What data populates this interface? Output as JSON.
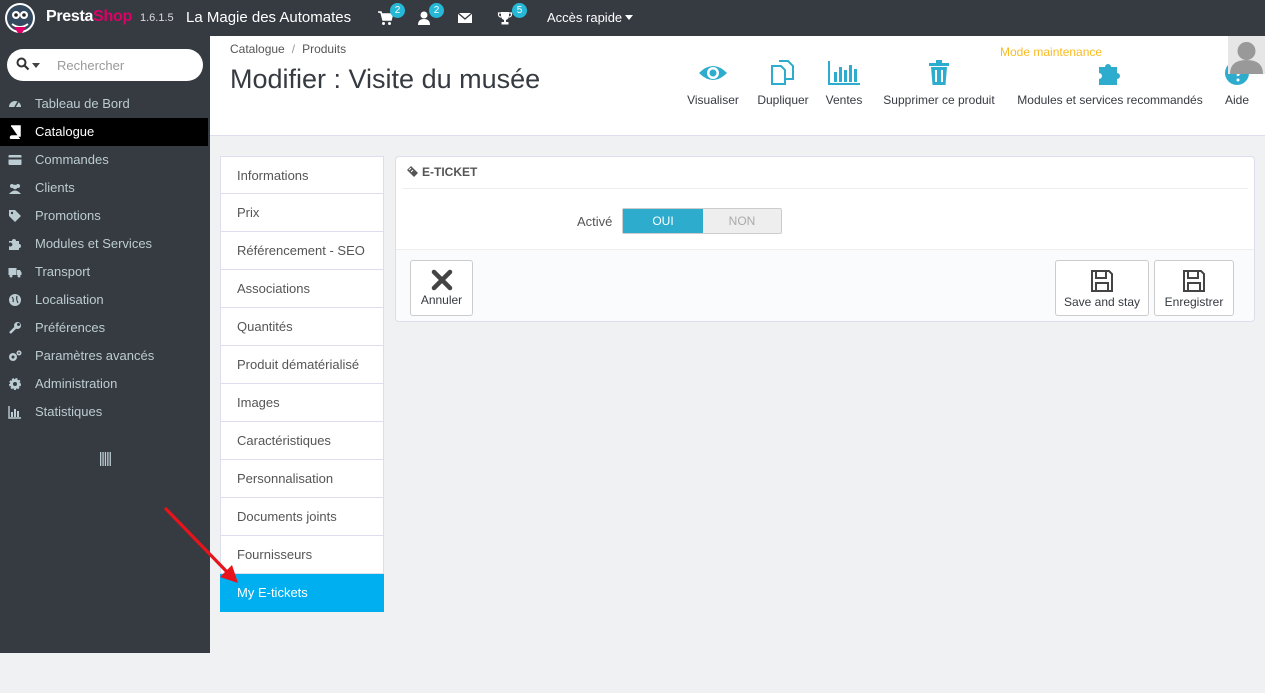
{
  "topbar": {
    "brand_part1": "Presta",
    "brand_part2": "Shop",
    "version": "1.6.1.5",
    "shop_name": "La Magie des Automates",
    "notifications": [
      {
        "icon": "cart-icon",
        "count": "2"
      },
      {
        "icon": "user-icon",
        "count": "2"
      },
      {
        "icon": "envelope-icon",
        "count": ""
      },
      {
        "icon": "trophy-icon",
        "count": "5"
      }
    ],
    "quick_access": "Accès rapide"
  },
  "sidebar": {
    "search_placeholder": "Rechercher",
    "items": [
      {
        "label": "Tableau de Bord",
        "icon": "dashboard-icon"
      },
      {
        "label": "Catalogue",
        "icon": "book-icon",
        "active": true
      },
      {
        "label": "Commandes",
        "icon": "credit-card-icon"
      },
      {
        "label": "Clients",
        "icon": "users-icon"
      },
      {
        "label": "Promotions",
        "icon": "tags-icon"
      },
      {
        "label": "Modules et Services",
        "icon": "puzzle-icon"
      },
      {
        "label": "Transport",
        "icon": "truck-icon"
      },
      {
        "label": "Localisation",
        "icon": "globe-icon"
      },
      {
        "label": "Préférences",
        "icon": "wrench-icon"
      },
      {
        "label": "Paramètres avancés",
        "icon": "cogs-icon"
      },
      {
        "label": "Administration",
        "icon": "cog-icon"
      },
      {
        "label": "Statistiques",
        "icon": "bar-chart-icon"
      }
    ]
  },
  "header": {
    "breadcrumb": [
      "Catalogue",
      "Produits"
    ],
    "title": "Modifier : Visite du musée",
    "maintenance": "Mode maintenance",
    "toolbar": {
      "view": "Visualiser",
      "duplicate": "Dupliquer",
      "sales": "Ventes",
      "delete": "Supprimer ce produit",
      "modules": "Modules et services recommandés",
      "help": "Aide"
    }
  },
  "tabs": [
    "Informations",
    "Prix",
    "Référencement - SEO",
    "Associations",
    "Quantités",
    "Produit dématérialisé",
    "Images",
    "Caractéristiques",
    "Personnalisation",
    "Documents joints",
    "Fournisseurs",
    "My E-tickets"
  ],
  "active_tab": "My E-tickets",
  "panel": {
    "heading": "E-TICKET",
    "field_label": "Activé",
    "switch_on": "OUI",
    "switch_off": "NON",
    "switch_value": "OUI",
    "cancel": "Annuler",
    "save_stay": "Save and stay",
    "save": "Enregistrer"
  },
  "colors": {
    "topbar": "#363a41",
    "accent": "#25b9d7",
    "active_tab": "#00aff0",
    "brand_pink": "#df0067",
    "maintenance": "#fbbb22",
    "annotation_arrow": "#e8141b"
  }
}
